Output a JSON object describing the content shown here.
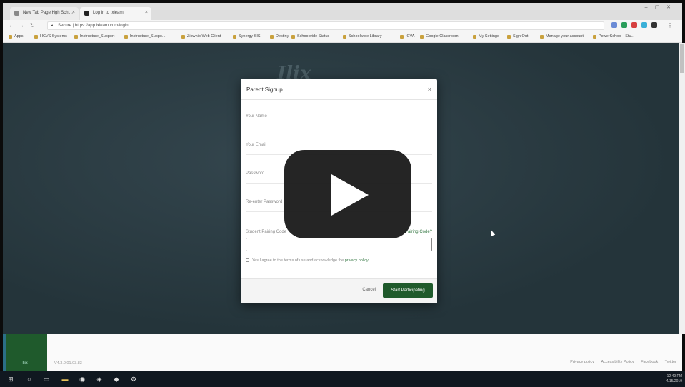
{
  "browser": {
    "tabs": [
      {
        "label": "New Tab Page Hgh Schl..."
      },
      {
        "label": "Log in to Ixlearn"
      }
    ],
    "address": "Secure | https://app.ixlearn.com/login"
  },
  "bookmarks": [
    "Apps",
    "HCVS Systems",
    "Instructure_Support",
    "Instructure_Suppo...",
    "Zipwhip Web Client",
    "Synergy SIS",
    "Destiny",
    "Schoolwide Status",
    "Schoolwide Library",
    "ICVA",
    "Google Classroom",
    "My Settings",
    "Sign Out",
    "Manage your account",
    "PowerSchool - Stu..."
  ],
  "page": {
    "bg_logo": "Ilix"
  },
  "modal": {
    "title": "Parent Signup",
    "close": "×",
    "fields": {
      "name": "Your Name",
      "email": "Your Email",
      "password": "Password",
      "password_repeat": "Re-enter Password",
      "student_code": "Student Pairing Code"
    },
    "pairing_link": "Pairing Code?",
    "terms_prefix": "Yes I agree to the terms of use and acknowledge the ",
    "terms_link": "privacy policy",
    "cancel": "Cancel",
    "start": "Start Participating"
  },
  "footer": {
    "brand": "Ilix",
    "version": "V4.3.0 01.03.83",
    "links": [
      "Privacy policy",
      "Accessibility Policy",
      "Facebook",
      "Twitter"
    ]
  },
  "taskbar": {
    "time": "12:49 PM",
    "date": "4/15/2019"
  },
  "colors": {
    "accent": "#1f5a2c",
    "page_bg": "#2b3c43"
  }
}
